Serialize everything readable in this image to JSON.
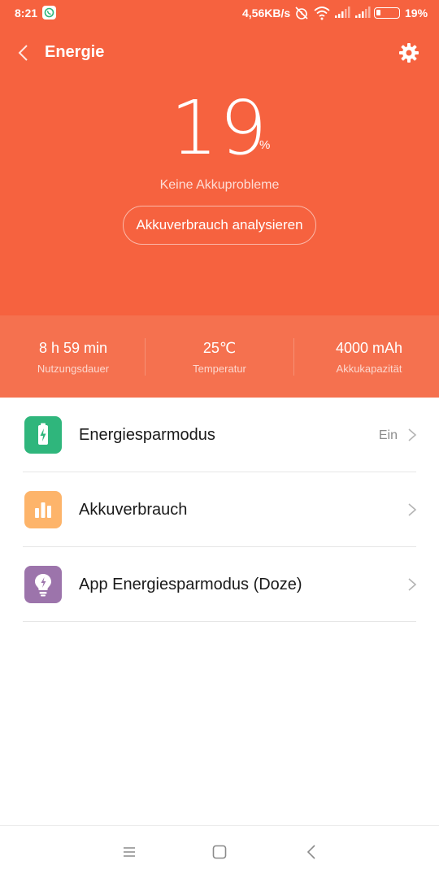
{
  "status_bar": {
    "time": "8:21",
    "speed": "4,56KB/s",
    "battery_pct": "19%",
    "battery_level": 0.19
  },
  "header": {
    "title": "Energie"
  },
  "battery": {
    "percent": "19",
    "percent_sign": "%",
    "status": "Keine Akkuprobleme",
    "analyze_label": "Akkuverbrauch analysieren"
  },
  "stats": [
    {
      "value": "8 h 59 min",
      "label": "Nutzungsdauer"
    },
    {
      "value": "25℃",
      "label": "Temperatur"
    },
    {
      "value": "4000 mAh",
      "label": "Akkukapazität"
    }
  ],
  "menu": [
    {
      "label": "Energiesparmodus",
      "value": "Ein",
      "icon": "battery-saver-icon",
      "color": "#2fb67c"
    },
    {
      "label": "Akkuverbrauch",
      "value": "",
      "icon": "bar-chart-icon",
      "color": "#fdb46a"
    },
    {
      "label": "App Energiesparmodus (Doze)",
      "value": "",
      "icon": "lightbulb-icon",
      "color": "#9c74ab"
    }
  ],
  "colors": {
    "accent": "#f6623f",
    "stats_band": "#f5714f"
  }
}
